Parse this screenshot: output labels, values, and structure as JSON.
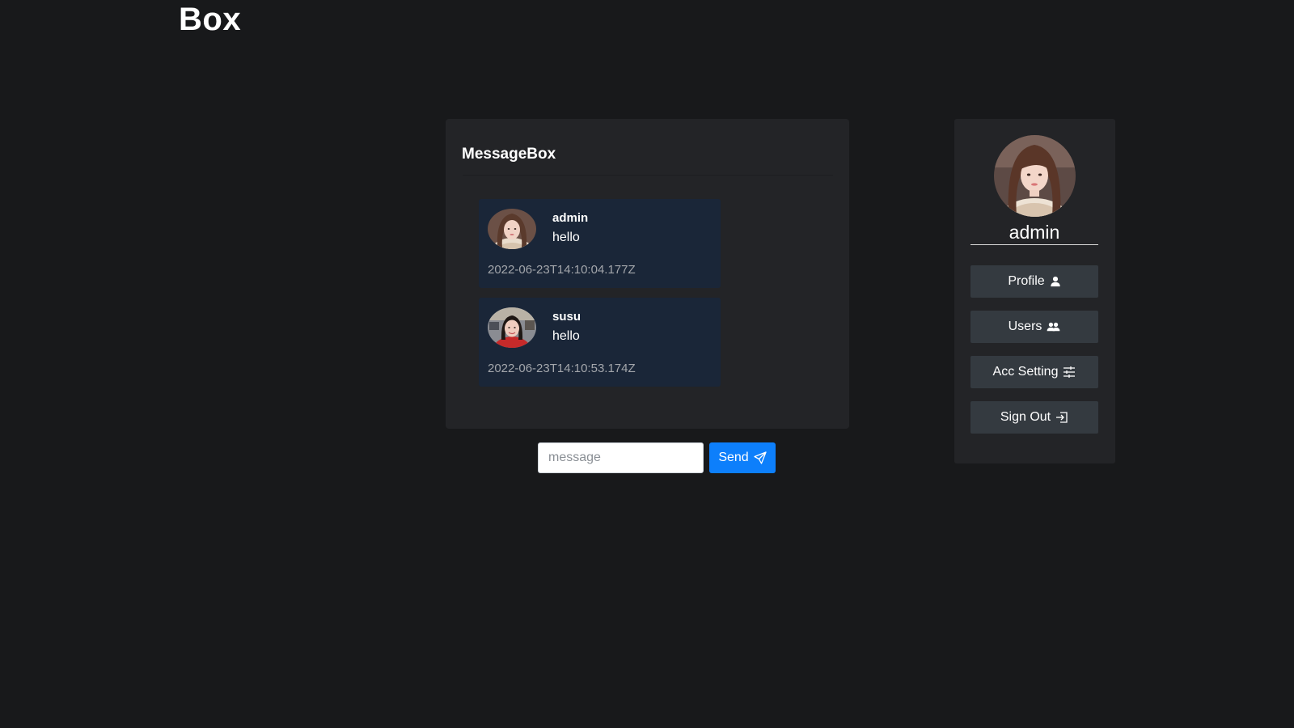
{
  "header": {
    "title": "Box"
  },
  "message_box": {
    "title": "MessageBox",
    "messages": [
      {
        "author": "admin",
        "text": "hello",
        "timestamp": "2022-06-23T14:10:04.177Z",
        "avatar_icon": "user-photo"
      },
      {
        "author": "susu",
        "text": "hello",
        "timestamp": "2022-06-23T14:10:53.174Z",
        "avatar_icon": "user-photo"
      }
    ]
  },
  "composer": {
    "placeholder": "message",
    "value": "",
    "send_label": "Send",
    "send_icon": "send-icon"
  },
  "sidebar": {
    "username": "admin",
    "items": [
      {
        "label": "Profile",
        "icon": "person-icon"
      },
      {
        "label": "Users",
        "icon": "people-icon"
      },
      {
        "label": "Acc Setting",
        "icon": "sliders-icon"
      },
      {
        "label": "Sign Out",
        "icon": "box-arrow-in-right-icon"
      }
    ]
  },
  "colors": {
    "page_bg": "#18191b",
    "card_bg": "#232427",
    "message_bg": "#1a2638",
    "accent": "#0d7ffb",
    "side_button_bg": "#343a40",
    "timestamp_text": "#a3a6ab"
  }
}
